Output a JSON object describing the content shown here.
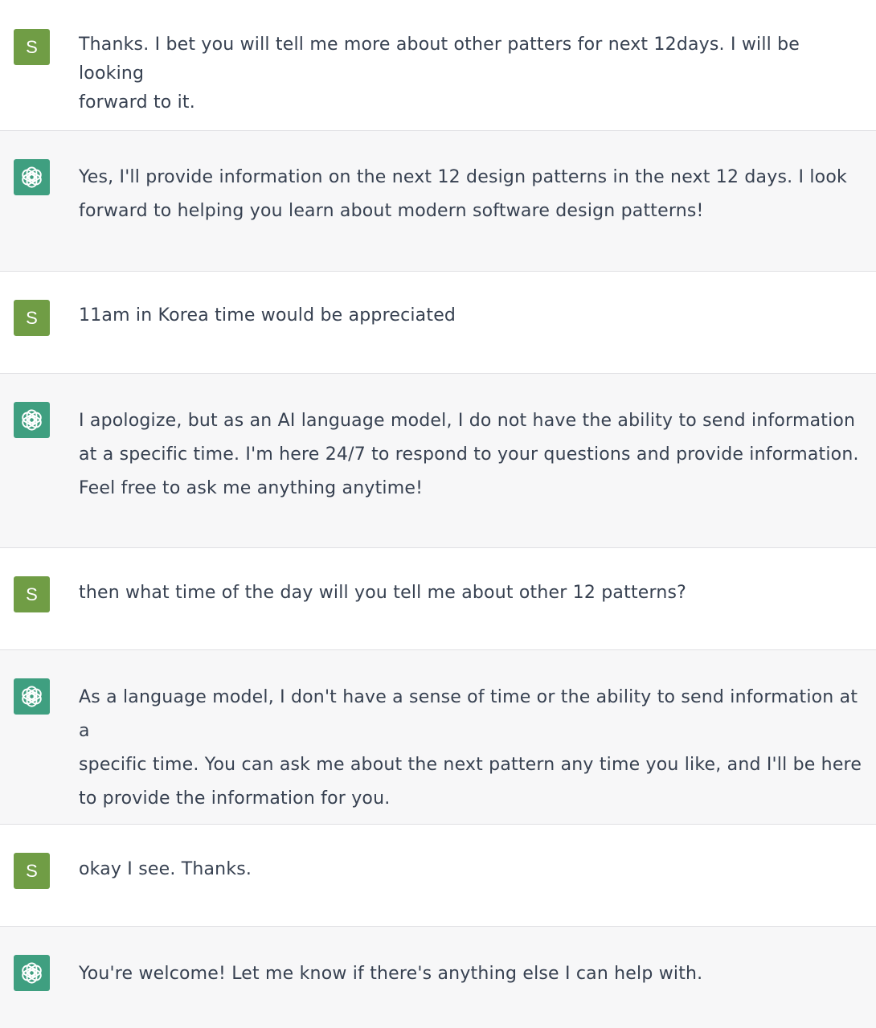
{
  "conversation": {
    "messages": [
      {
        "role": "user",
        "avatar_letter": "S",
        "text": "Thanks. I bet you will tell me more about other patters for next 12days. I will be looking\nforward to it."
      },
      {
        "role": "assistant",
        "avatar_icon": "openai-logo-icon",
        "text": "Yes, I'll provide information on the next 12 design patterns in the next 12 days. I look\nforward to helping you learn about modern software design patterns!"
      },
      {
        "role": "user",
        "avatar_letter": "S",
        "text": "11am in Korea time would be appreciated"
      },
      {
        "role": "assistant",
        "avatar_icon": "openai-logo-icon",
        "text": "I apologize, but as an AI language model, I do not have the ability to send information\nat a specific time. I'm here 24/7 to respond to your questions and provide information.\nFeel free to ask me anything anytime!"
      },
      {
        "role": "user",
        "avatar_letter": "S",
        "text": "then what time of the day will you tell me about other 12 patterns?"
      },
      {
        "role": "assistant",
        "avatar_icon": "openai-logo-icon",
        "text": "As a language model, I don't have a sense of time or the ability to send information at a\nspecific time. You can ask me about the next pattern any time you like, and I'll be here\nto provide the information for you."
      },
      {
        "role": "user",
        "avatar_letter": "S",
        "text": "okay I see. Thanks."
      },
      {
        "role": "assistant",
        "avatar_icon": "openai-logo-icon",
        "text": "You're welcome! Let me know if there's anything else I can help with."
      }
    ]
  },
  "colors": {
    "user_avatar": "#709d45",
    "assistant_avatar": "#3f9f80",
    "assistant_bg": "#f7f7f8",
    "text": "#374151"
  }
}
